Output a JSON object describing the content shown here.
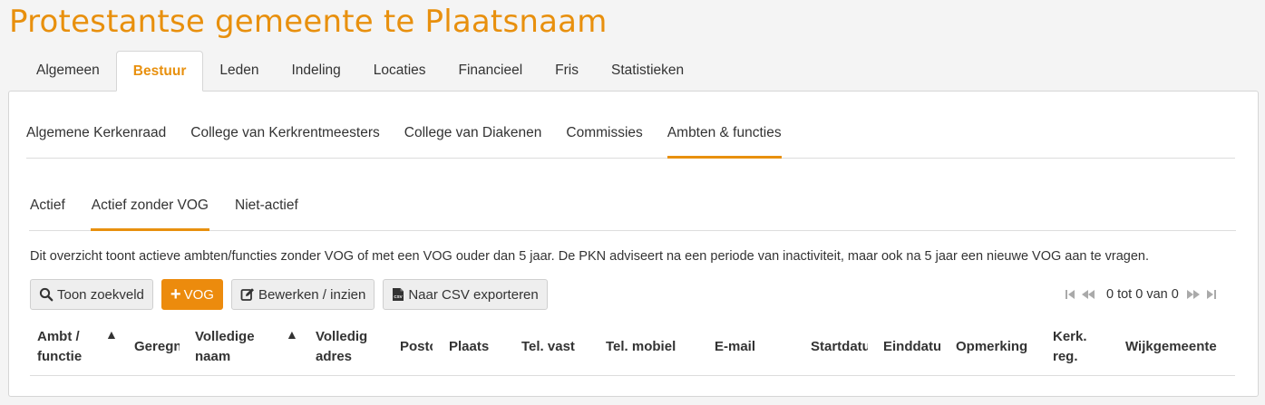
{
  "title": "Protestantse gemeente te Plaatsnaam",
  "main_tabs": [
    "Algemeen",
    "Bestuur",
    "Leden",
    "Indeling",
    "Locaties",
    "Financieel",
    "Fris",
    "Statistieken"
  ],
  "sub_tabs": [
    "Algemene Kerkenraad",
    "College van Kerkrentmeesters",
    "College van Diakenen",
    "Commissies",
    "Ambten & functies"
  ],
  "vog_tabs": [
    "Actief",
    "Actief zonder VOG",
    "Niet-actief"
  ],
  "description": "Dit overzicht toont actieve ambten/functies zonder VOG of met een VOG ouder dan 5 jaar. De PKN adviseert na een periode van inactiviteit, maar ook na 5 jaar een nieuwe VOG aan te vragen.",
  "toolbar": {
    "search_label": "Toon zoekveld",
    "add_label": "VOG",
    "edit_label": "Bewerken / inzien",
    "csv_label": "Naar CSV exporteren"
  },
  "pager": {
    "info": "0 tot 0 van 0"
  },
  "sort_symbol": "▲",
  "columns": [
    "Ambt /\nfunctie",
    "Geregn",
    "Volledige\nnaam",
    "Volledig\nadres",
    "Postc",
    "Plaats",
    "Tel. vast",
    "Tel. mobiel",
    "E-mail",
    "Startdatu",
    "Einddatu",
    "Opmerking",
    "Kerk.\nreg.",
    "Wijkgemeente"
  ],
  "colors": {
    "accent": "#e8900e",
    "button_primary": "#ec8b0d",
    "button_default": "#eeeeee"
  },
  "icons": [
    "search-icon",
    "plus-icon",
    "edit-icon",
    "csv-file-icon",
    "first-page-icon",
    "previous-page-icon",
    "next-page-icon",
    "last-page-icon"
  ]
}
